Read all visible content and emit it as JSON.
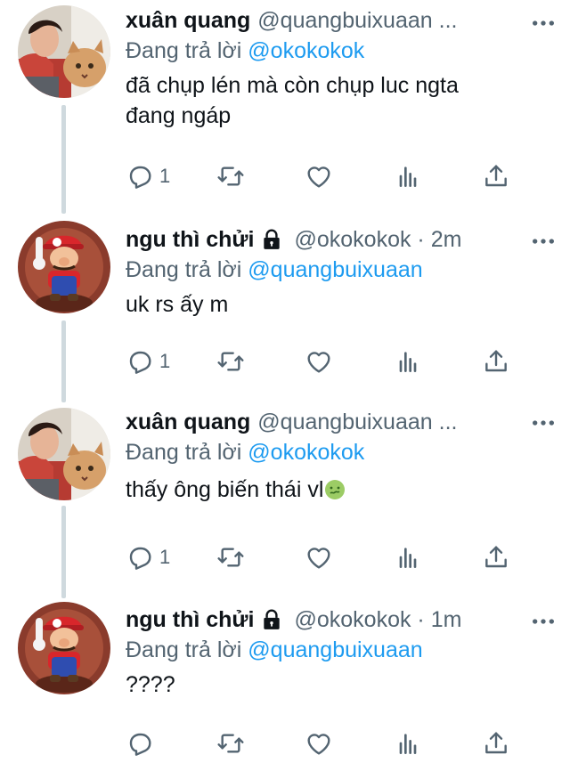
{
  "tweets": [
    {
      "name": "xuân quang",
      "handle": "@quangbuixuaan ...",
      "locked": false,
      "reply_prefix": "Đang trả lời",
      "reply_to": "@okokokok",
      "text_lines": [
        "đã chụp lén mà còn chụp luc ngta",
        "đang ngáp"
      ],
      "reply_count": "1",
      "avatar": "avatar-person-cat"
    },
    {
      "name": "ngu thì chửi",
      "handle": "@okokokok · 2m",
      "locked": true,
      "reply_prefix": "Đang trả lời",
      "reply_to": "@quangbuixuaan",
      "text_lines": [
        "uk rs ấy m"
      ],
      "reply_count": "1",
      "avatar": "avatar-mario"
    },
    {
      "name": "xuân quang",
      "handle": "@quangbuixuaan ...",
      "locked": false,
      "reply_prefix": "Đang trả lời",
      "reply_to": "@okokokok",
      "text_lines": [
        "thấy ông biến thái vl"
      ],
      "text_emoji": "nauseated-face-emoji",
      "reply_count": "1",
      "avatar": "avatar-person-cat"
    },
    {
      "name": "ngu thì chửi",
      "handle": "@okokokok · 1m",
      "locked": true,
      "reply_prefix": "Đang trả lời",
      "reply_to": "@quangbuixuaan",
      "text_lines": [
        "????"
      ],
      "reply_count": "",
      "avatar": "avatar-mario"
    }
  ],
  "colors": {
    "accent": "#1d9bf0",
    "secondary": "#536471",
    "thread_line": "#cfd9de"
  },
  "icons": [
    "reply-icon",
    "retweet-icon",
    "like-icon",
    "views-icon",
    "share-icon",
    "more-icon",
    "lock-icon"
  ]
}
